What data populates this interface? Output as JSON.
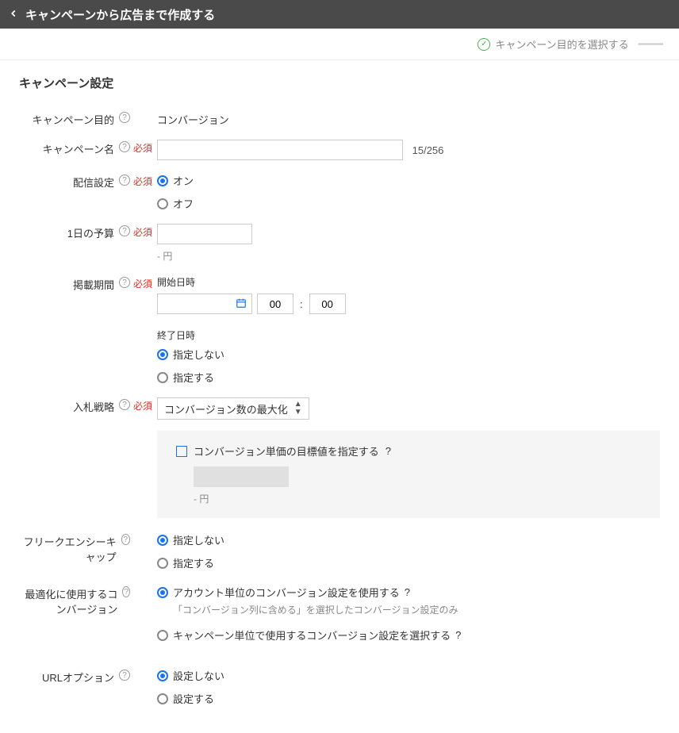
{
  "header": {
    "title": "キャンペーンから広告まで作成する"
  },
  "subheader": {
    "step_label": "キャンペーン目的を選択する"
  },
  "section_title": "キャンペーン設定",
  "required_label": "必須",
  "labels": {
    "objective": "キャンペーン目的",
    "name": "キャンペーン名",
    "delivery": "配信設定",
    "budget": "1日の予算",
    "period": "掲載期間",
    "bid": "入札戦略",
    "freqcap": "フリークエンシーキャップ",
    "optconv": "最適化に使用するコンバージョン",
    "urlopt": "URLオプション"
  },
  "objective": {
    "value": "コンバージョン"
  },
  "name": {
    "value": "",
    "counter": "15/256"
  },
  "delivery": {
    "on": "オン",
    "off": "オフ"
  },
  "budget": {
    "value": "",
    "hint": "- 円"
  },
  "period": {
    "start_label": "開始日時",
    "date_value": "",
    "hour": "00",
    "minute": "00",
    "end_label": "終了日時",
    "end_none": "指定しない",
    "end_set": "指定する"
  },
  "bid": {
    "selected": "コンバージョン数の最大化",
    "cpa_checkbox_label": "コンバージョン単価の目標値を指定する",
    "cpa_hint": "- 円"
  },
  "freqcap": {
    "none": "指定しない",
    "set": "指定する"
  },
  "optconv": {
    "account": "アカウント単位のコンバージョン設定を使用する",
    "account_desc": "「コンバージョン列に含める」を選択したコンバージョン設定のみ",
    "campaign": "キャンペーン単位で使用するコンバージョン設定を選択する"
  },
  "urlopt": {
    "none": "設定しない",
    "set": "設定する"
  }
}
